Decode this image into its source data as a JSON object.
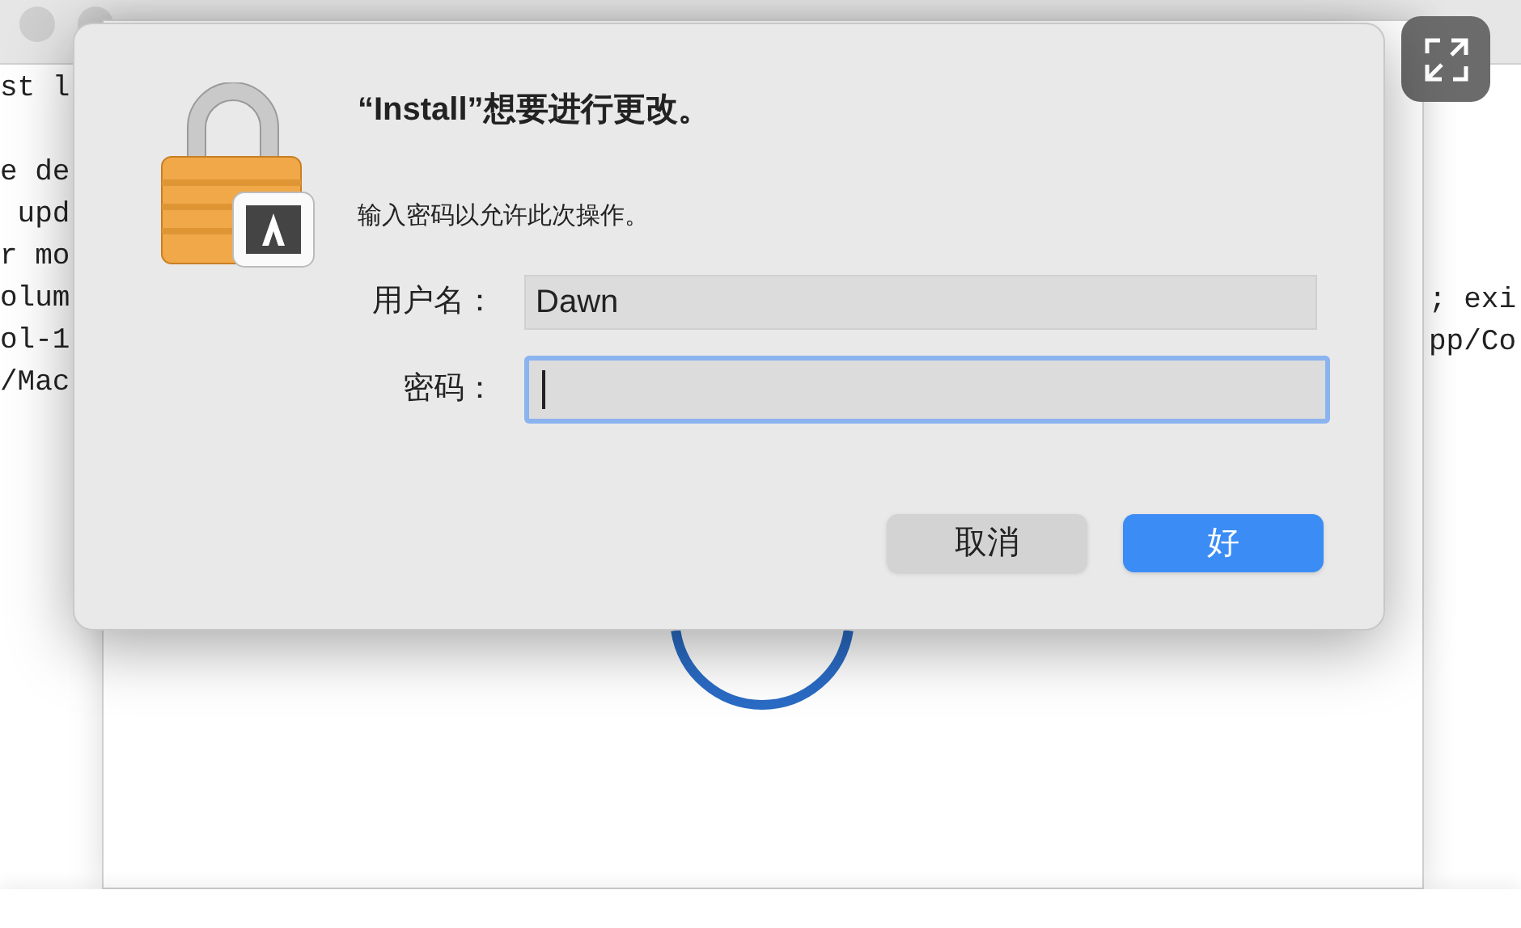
{
  "terminal": {
    "left_blocks": [
      [
        "st l"
      ],
      [
        "e de",
        " upd",
        "r mo",
        "olum",
        "ol-1",
        "/Mac"
      ]
    ],
    "right_lines": [
      "; exi",
      "pp/Co"
    ]
  },
  "dialog": {
    "title": "“Install”想要进行更改。",
    "message": "输入密码以允许此次操作。",
    "fields": [
      {
        "label": "用户名：",
        "value": "Dawn",
        "focused": false
      },
      {
        "label": "密码：",
        "focused": true
      }
    ],
    "buttons": [
      {
        "label": "取消",
        "default": false
      },
      {
        "label": "好",
        "default": true
      }
    ]
  }
}
